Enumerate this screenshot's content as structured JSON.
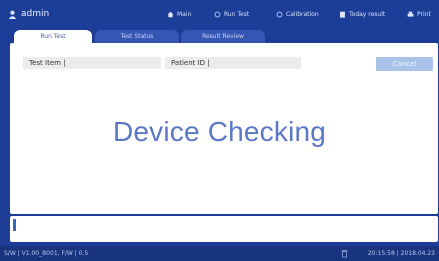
{
  "header": {
    "user": "admin",
    "nav": [
      {
        "label": "Main",
        "icon": "home-icon"
      },
      {
        "label": "Run Test",
        "icon": "radio-icon"
      },
      {
        "label": "Calibration",
        "icon": "radio-icon"
      },
      {
        "label": "Today result",
        "icon": "clipboard-icon"
      },
      {
        "label": "Print",
        "icon": "print-icon"
      }
    ]
  },
  "tabs": [
    {
      "label": "Run Test",
      "active": true
    },
    {
      "label": "Test Status",
      "active": false
    },
    {
      "label": "Result Review",
      "active": false
    }
  ],
  "form": {
    "test_item": "Test Item |",
    "patient_id": "Patient ID |",
    "cancel_label": "Cancel"
  },
  "main": {
    "message": "Device Checking"
  },
  "status": {
    "version": "S/W | V1.00_B001, F/W | 0.5",
    "datetime": "20:15:58 | 2018.04.23"
  },
  "colors": {
    "background": "#1c3c96",
    "tab_active": "#ffffff",
    "tab_inactive": "#3656b3",
    "cancel_button": "#a8c2ea",
    "message_text": "#5b78c6"
  }
}
